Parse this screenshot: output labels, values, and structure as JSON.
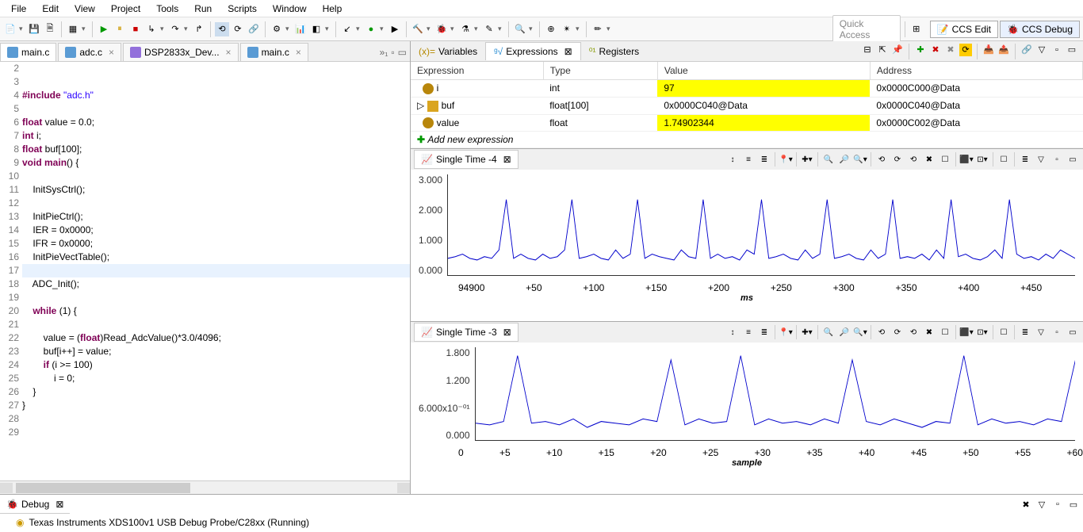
{
  "menu": [
    "File",
    "Edit",
    "View",
    "Project",
    "Tools",
    "Run",
    "Scripts",
    "Window",
    "Help"
  ],
  "quickAccess": "Quick Access",
  "perspectives": {
    "edit": "CCS Edit",
    "debug": "CCS Debug"
  },
  "editorTabs": [
    {
      "label": "main.c",
      "type": "c",
      "active": true
    },
    {
      "label": "adc.c",
      "type": "c"
    },
    {
      "label": "DSP2833x_Dev...",
      "type": "h"
    },
    {
      "label": "main.c",
      "type": "c"
    }
  ],
  "code": [
    {
      "n": 2,
      "t": ""
    },
    {
      "n": 3,
      "t": ""
    },
    {
      "n": 4,
      "html": "<span class='pp'>#include</span> <span class='str'>\"adc.h\"</span>"
    },
    {
      "n": 5,
      "t": ""
    },
    {
      "n": 6,
      "html": "<span class='kw'>float</span> value = 0.0;"
    },
    {
      "n": 7,
      "html": "<span class='kw'>int</span> i;"
    },
    {
      "n": 8,
      "html": "<span class='kw'>float</span> buf[100];"
    },
    {
      "n": 9,
      "html": "<span class='kw'>void</span> <span class='kw'>main</span>() {"
    },
    {
      "n": 10,
      "t": ""
    },
    {
      "n": 11,
      "t": "    InitSysCtrl();"
    },
    {
      "n": 12,
      "t": ""
    },
    {
      "n": 13,
      "t": "    InitPieCtrl();"
    },
    {
      "n": 14,
      "t": "    IER = 0x0000;"
    },
    {
      "n": 15,
      "t": "    IFR = 0x0000;"
    },
    {
      "n": 16,
      "t": "    InitPieVectTable();"
    },
    {
      "n": 17,
      "t": "",
      "hl": true
    },
    {
      "n": 18,
      "t": "    ADC_Init();"
    },
    {
      "n": 19,
      "t": ""
    },
    {
      "n": 20,
      "html": "    <span class='kw'>while</span> (1) {"
    },
    {
      "n": 21,
      "t": ""
    },
    {
      "n": 22,
      "html": "        value = (<span class='kw'>float</span>)Read_AdcValue()*3.0/4096;"
    },
    {
      "n": 23,
      "t": "        buf[i++] = value;"
    },
    {
      "n": 24,
      "html": "        <span class='kw'>if</span> (i >= 100)"
    },
    {
      "n": 25,
      "t": "            i = 0;"
    },
    {
      "n": 26,
      "t": "    }"
    },
    {
      "n": 27,
      "t": "}"
    },
    {
      "n": 28,
      "t": ""
    },
    {
      "n": 29,
      "t": ""
    }
  ],
  "rightTabs": {
    "vars": "Variables",
    "expr": "Expressions",
    "reg": "Registers"
  },
  "exprHeaders": [
    "Expression",
    "Type",
    "Value",
    "Address"
  ],
  "exprRows": [
    {
      "e": "i",
      "t": "int",
      "v": "97",
      "a": "0x0000C000@Data",
      "hl": true,
      "ic": "xi"
    },
    {
      "e": "buf",
      "t": "float[100]",
      "v": "0x0000C040@Data",
      "a": "0x0000C040@Data",
      "ic": "bi",
      "expandable": true
    },
    {
      "e": "value",
      "t": "float",
      "v": "1.74902344",
      "a": "0x0000C002@Data",
      "hl": true,
      "ic": "xi"
    }
  ],
  "addExpr": "Add new expression",
  "graphs": {
    "g1": {
      "title": "Single Time -4",
      "ylabels": [
        "3.000",
        "2.000",
        "1.000",
        "0.000"
      ],
      "xstart": "94900",
      "xticks": [
        "+50",
        "+100",
        "+150",
        "+200",
        "+250",
        "+300",
        "+350",
        "+400",
        "+450",
        ""
      ],
      "xlabel": "ms"
    },
    "g2": {
      "title": "Single Time -3",
      "ylabels": [
        "1.800",
        "1.200",
        "6.000x10⁻⁰¹",
        "0.000"
      ],
      "xticks": [
        "0",
        "+5",
        "+10",
        "+15",
        "+20",
        "+25",
        "+30",
        "+35",
        "+40",
        "+45",
        "+50",
        "+55",
        "+60"
      ],
      "xlabel": "sample"
    }
  },
  "debug": {
    "tab": "Debug",
    "status": "Texas Instruments XDS100v1 USB Debug Probe/C28xx (Running)"
  },
  "chart_data": [
    {
      "type": "line",
      "title": "Single Time -4",
      "xlabel": "ms",
      "ylabel": "",
      "ylim": [
        0,
        3.0
      ],
      "xstart": 94900,
      "note": "repeating spikes to ~2.0 every ~75ms on baseline ~0.5",
      "series": [
        {
          "name": "buf",
          "values": [
            0.5,
            0.4,
            0.6,
            0.5,
            2.0,
            0.7,
            0.4,
            0.5,
            0.6,
            0.4,
            2.0,
            0.5,
            0.6,
            0.4,
            0.5,
            0.7,
            2.0,
            0.5,
            0.4,
            0.6
          ]
        }
      ]
    },
    {
      "type": "line",
      "title": "Single Time -3",
      "xlabel": "sample",
      "ylabel": "",
      "ylim": [
        0,
        1.9
      ],
      "x": [
        0,
        5,
        10,
        15,
        20,
        25,
        30,
        35,
        40,
        45,
        50,
        55,
        60
      ],
      "series": [
        {
          "name": "buf",
          "values": [
            0.3,
            1.9,
            0.4,
            0.5,
            0.3,
            1.9,
            0.4,
            0.3,
            0.5,
            1.9,
            0.3,
            0.4,
            0.3,
            1.8,
            0.5,
            0.3,
            0.4,
            1.9,
            0.5,
            0.3
          ]
        }
      ]
    }
  ]
}
